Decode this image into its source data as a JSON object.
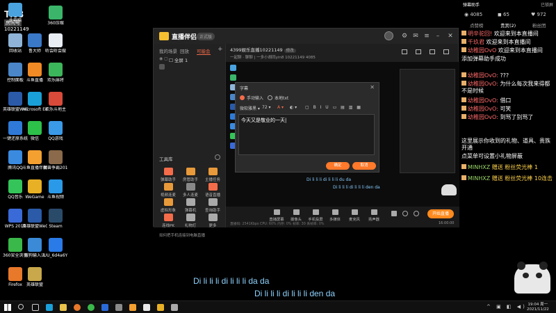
{
  "desktop": {
    "corner_logo": "Ti68",
    "corner_label": "房间号",
    "corner_number": "10221149",
    "icons": [
      {
        "label": "此电脑",
        "color": "#4aa3df"
      },
      {
        "label": "360压缩",
        "color": "#3bb56a"
      },
      {
        "label": "回收站",
        "color": "#8fb4d8"
      },
      {
        "label": "鲁大师",
        "color": "#3a78c8"
      },
      {
        "label": "听会听会做",
        "color": "#e8eef4"
      },
      {
        "label": "控制面板",
        "color": "#4a86c8"
      },
      {
        "label": "斗鱼直播",
        "color": "#f08a24"
      },
      {
        "label": "欢乐麻将",
        "color": "#3cb65a"
      },
      {
        "label": "英雄联盟WeGame版",
        "color": "#2a5aa8"
      },
      {
        "label": "Microsoft Edge",
        "color": "#1aa0d8"
      },
      {
        "label": "欢乐斗地主",
        "color": "#d84a3a"
      },
      {
        "label": "一键还原系统",
        "color": "#2f7ad8"
      },
      {
        "label": "微信",
        "color": "#2dc14a"
      },
      {
        "label": "QQ游戏",
        "color": "#3a9ae8"
      },
      {
        "label": "腾讯QQ",
        "color": "#3a8ae0"
      },
      {
        "label": "斗鱼直播伴侣",
        "color": "#f4a030"
      },
      {
        "label": "魔兽争霸2010单机版",
        "color": "#8a6a4a"
      },
      {
        "label": "QQ音乐",
        "color": "#34c45a"
      },
      {
        "label": "WeGame",
        "color": "#e8b024"
      },
      {
        "label": "斗鱼视频",
        "color": "#2a9ae8"
      },
      {
        "label": "WPS 2019",
        "color": "#3a6ad8"
      },
      {
        "label": "英雄联盟WeGame版",
        "color": "#2a5aa8"
      },
      {
        "label": "Steam",
        "color": "#2a4a6a"
      },
      {
        "label": "360安全浏览器",
        "color": "#3ab84a"
      },
      {
        "label": "搜狗输入法",
        "color": "#3a8ad8"
      },
      {
        "label": "UU_6d4a6Y",
        "color": "#2a7ae8"
      },
      {
        "label": "Firefox",
        "color": "#e8782a"
      },
      {
        "label": "英雄联盟",
        "color": "#c8a84a"
      }
    ]
  },
  "app": {
    "name": "直播伴侣",
    "version_badge": "正式版",
    "left_tabs": [
      "我的场景",
      "回放",
      "可能会"
    ],
    "scene_name": "全屏 1",
    "tools_title": "工具库",
    "tools": [
      {
        "label": "弹幕助手",
        "color": "#f46c4a"
      },
      {
        "label": "房管助手",
        "color": "#e89a3a"
      },
      {
        "label": "主播任务",
        "color": "#e89a3a"
      },
      {
        "label": "视频连麦",
        "color": "#e89a3a"
      },
      {
        "label": "多人连麦",
        "color": "#888"
      },
      {
        "label": "语音直播",
        "color": "#f46c4a"
      },
      {
        "label": "虚拟形象",
        "color": "#e89a3a"
      },
      {
        "label": "弹幕机",
        "color": "#aaa"
      },
      {
        "label": "查询助手",
        "color": "#aaa"
      },
      {
        "label": "连线PK",
        "color": "#f46c4a"
      },
      {
        "label": "礼物灯",
        "color": "#aaa"
      },
      {
        "label": "更多",
        "color": "#aaa"
      }
    ],
    "phone_tip": "如何把手机连接到电脑直播",
    "room_title": "4399娱乐直播10221149",
    "room_tag": "修改",
    "room_sub": "一起聊 · 聊聊  |  一多小胡同yin8  10221149  4085",
    "top_icons": [
      "背景",
      "房间",
      "设置",
      "更多"
    ],
    "preview_sub_1": "Di li li li di li li li du da",
    "preview_sub_2": "Di li li li di li li li den da",
    "bottom_items": [
      "直播屏幕",
      "摄像头",
      "手机投屏",
      "多媒体",
      "麦克风",
      "扬声器"
    ],
    "start_label": "开始直播",
    "status_line": "直播码: 2541Kbps   CPU: 60%   内存: 0%   帧率: 30   丢帧率: 0%",
    "time": "16:00:00"
  },
  "dialog": {
    "title": "字幕",
    "radio_1": "手动输入",
    "radio_2": "本地txt",
    "font_select": "微软雅黑",
    "font_size": "72",
    "text": "今天又是敬业的一天",
    "confirm": "确定",
    "cancel": "取消"
  },
  "chat": {
    "title": "弹幕助手",
    "status": "已锁屏",
    "stats": [
      "4085",
      "65",
      "972"
    ],
    "tabs": [
      "点赞榜",
      "贵宾(2)",
      "粉丝团"
    ],
    "messages": [
      {
        "user": "明辛驼回!",
        "text": "欢迎来到本直播间"
      },
      {
        "user": "千玖君",
        "text": "欢迎来到本直播间"
      },
      {
        "user": "幼稚园OvO",
        "text": "欢迎来到本直播间"
      },
      {
        "user": "",
        "text": "添加弹幕助手成功"
      },
      {
        "user": "幼稚园OvO:",
        "text": "???"
      },
      {
        "user": "幼稚园OvO:",
        "text": "为什么每次我来得都不是时候"
      },
      {
        "user": "幼稚园OvO:",
        "text": "借口"
      },
      {
        "user": "幼稚园OvO:",
        "text": "可笑"
      },
      {
        "user": "幼稚园OvO:",
        "text": "到骂了别骂了"
      },
      {
        "user": "",
        "text": "这里展示你收到的礼物、道具、贵族开通"
      },
      {
        "user": "",
        "text": "点菜单可设置小礼物屏蔽"
      },
      {
        "user": "MINHXZ",
        "text": "赠送 粉丝荧光棒 1"
      },
      {
        "user": "MINHXZ",
        "text": "赠送 粉丝荧光棒 10连击"
      }
    ]
  },
  "lyrics": {
    "line_1": "Di li li li di li li li da da",
    "line_2": "Di li li li di li li li den da"
  },
  "taskbar": {
    "time": "19:04 周一",
    "date": "2021/11/22"
  }
}
